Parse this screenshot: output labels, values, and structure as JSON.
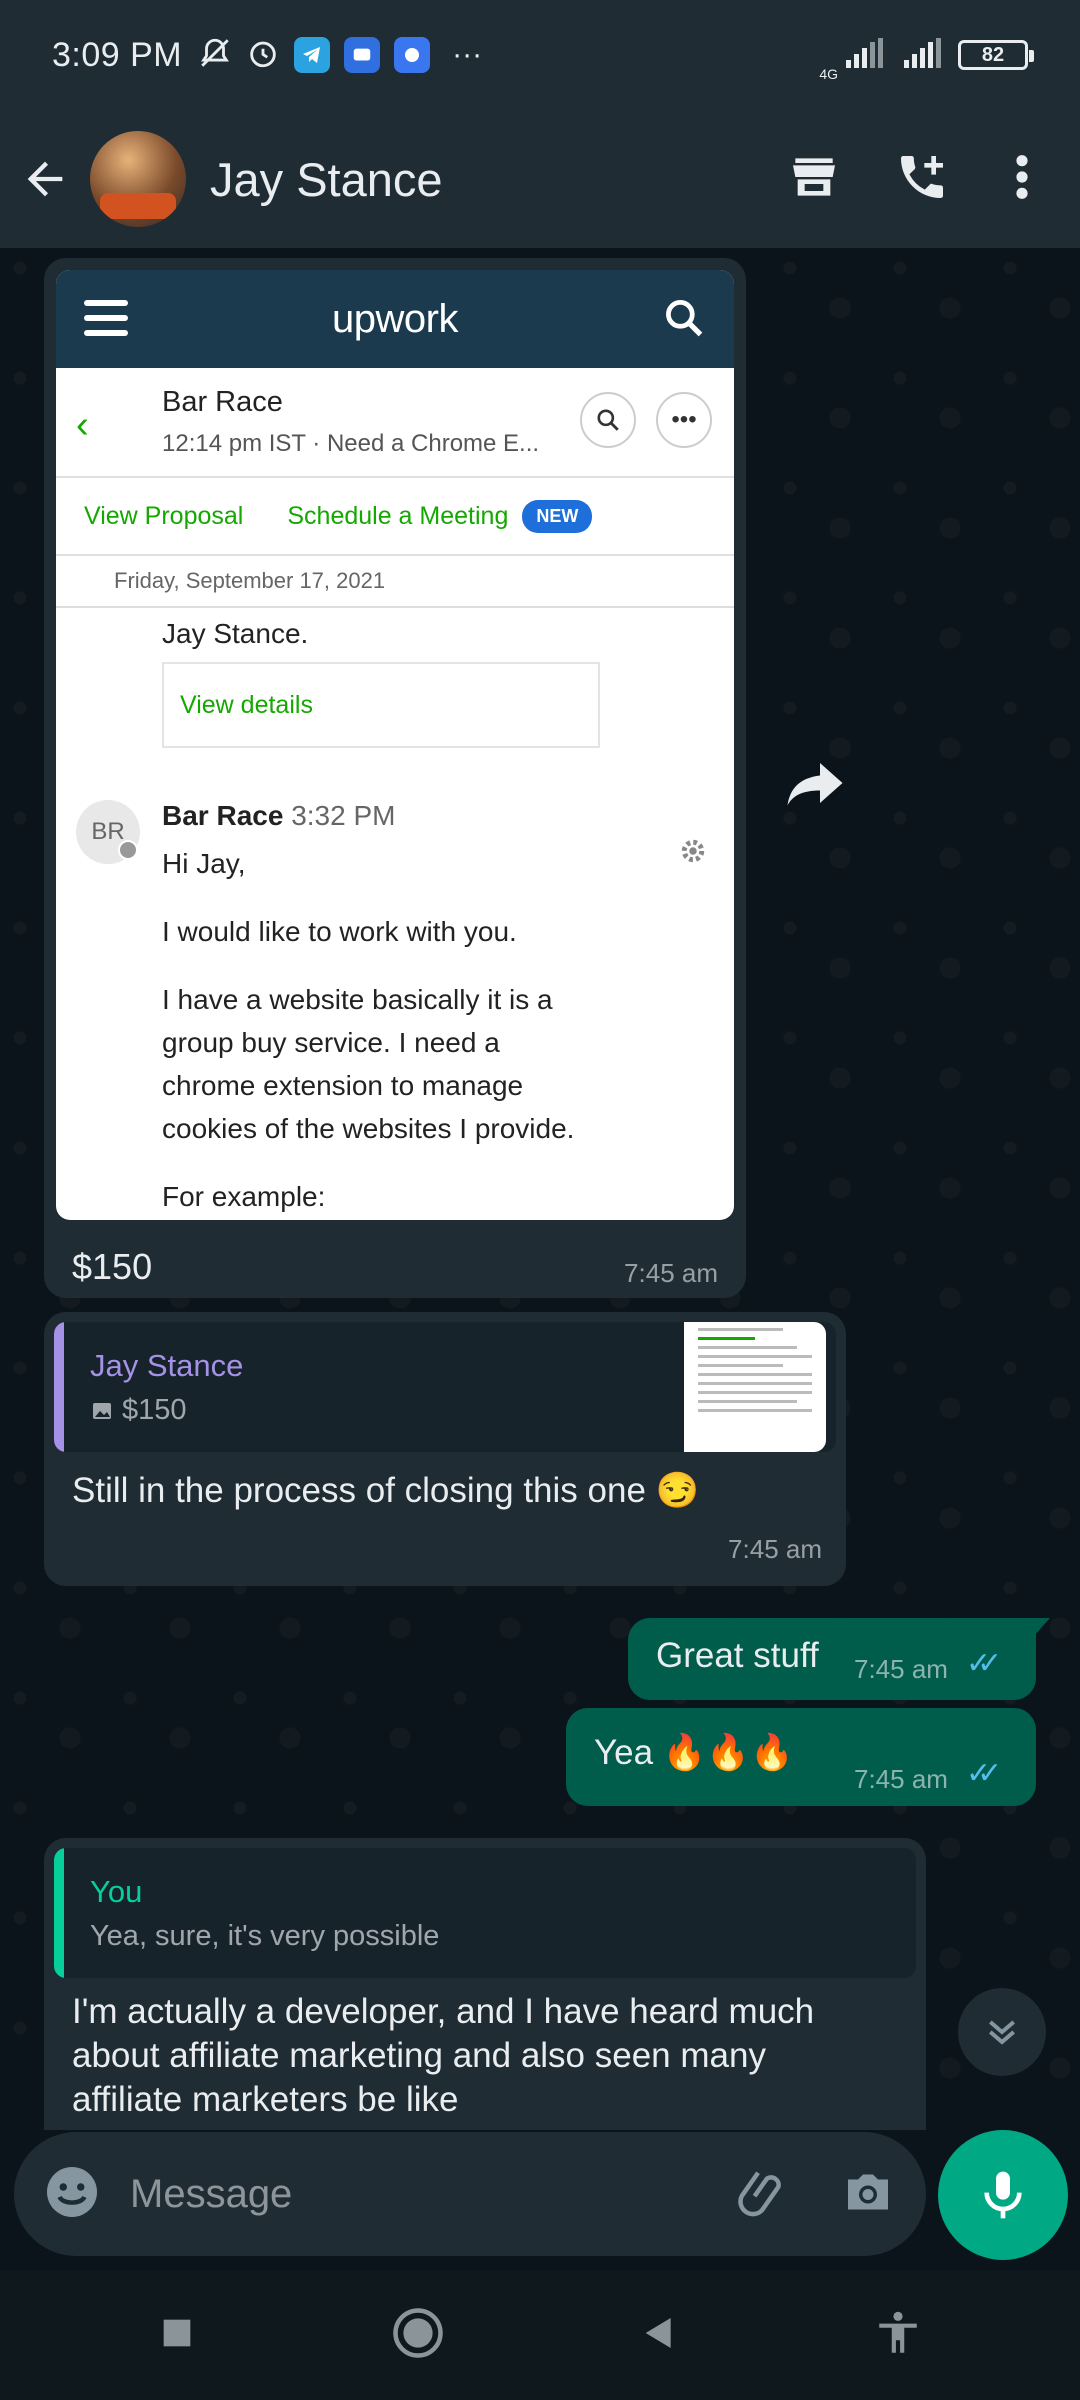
{
  "status_bar": {
    "time": "3:09 PM",
    "more": "···",
    "network": "4G",
    "battery": "82"
  },
  "header": {
    "contact_name": "Jay Stance"
  },
  "image_message": {
    "screenshot": {
      "logo": "upwork",
      "title": "Bar Race",
      "subtitle": "12:14 pm IST · Need a Chrome E...",
      "link_proposal": "View Proposal",
      "link_meeting": "Schedule a Meeting",
      "new_badge": "NEW",
      "date": "Friday, September 17, 2021",
      "prev_sender": "Jay Stance.",
      "view_details": "View details",
      "avatar_initials": "BR",
      "sender": "Bar Race",
      "sender_time": "3:32 PM",
      "lines": [
        "Hi Jay,",
        "I would like to work with you.",
        "I have a website basically it is a",
        "group buy service. I need a",
        "chrome extension to manage",
        "cookies of the websites I provide.",
        "For example:"
      ]
    },
    "caption": "$150",
    "time": "7:45 am"
  },
  "reply_message": {
    "quote_name": "Jay Stance",
    "quote_text": "$150",
    "text": "Still in the process of closing this one 😏",
    "time": "7:45 am",
    "quote_color": "#a591e6"
  },
  "outgoing": [
    {
      "text": "Great stuff",
      "time": "7:45 am"
    },
    {
      "text": "Yea 🔥🔥🔥",
      "time": "7:45 am"
    }
  ],
  "last_message": {
    "quote_name": "You",
    "quote_text": "Yea, sure, it's very possible",
    "text": "I'm actually a developer, and I have heard much about affiliate marketing and also seen many affiliate marketers be like",
    "quote_color": "#06cf9c"
  },
  "composer": {
    "placeholder": "Message"
  },
  "colors": {
    "accent": "#00a884",
    "outgoing_bubble": "#005c4b",
    "incoming_bubble": "#1f2c34",
    "read_ticks": "#53bdeb"
  }
}
